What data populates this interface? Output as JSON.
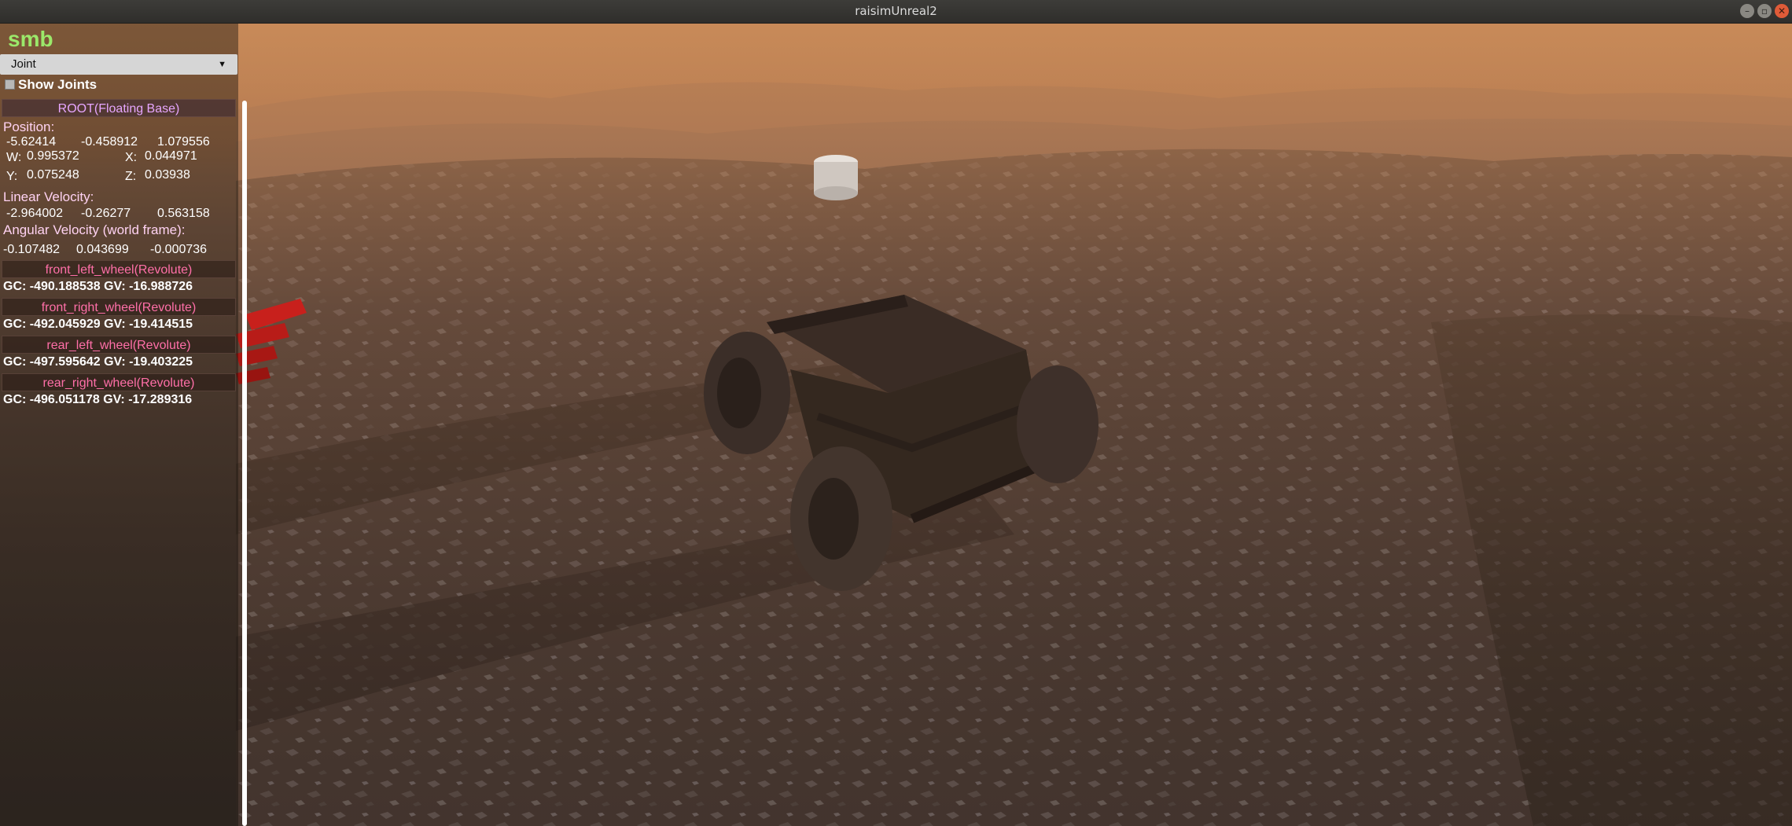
{
  "window": {
    "title": "raisimUnreal2"
  },
  "panel": {
    "object_name": "smb",
    "mode_select": "Joint",
    "show_joints_label": "Show Joints",
    "root": {
      "header": "ROOT(Floating Base)",
      "position_label": "Position:",
      "position": [
        "-5.62414",
        "-0.458912",
        "1.079556"
      ],
      "quat": {
        "w_label": "W:",
        "w": "0.995372",
        "x_label": "X:",
        "x": "0.044971",
        "y_label": "Y:",
        "y": "0.075248",
        "z_label": "Z:",
        "z": "0.03938"
      },
      "lin_vel_label": "Linear Velocity:",
      "lin_vel": [
        "-2.964002",
        "-0.26277",
        "0.563158"
      ],
      "ang_vel_label": "Angular Velocity (world frame):",
      "ang_vel": [
        "-0.107482",
        "0.043699",
        "-0.000736"
      ]
    },
    "joints": [
      {
        "header": "front_left_wheel(Revolute)",
        "state": "GC: -490.188538  GV: -16.988726"
      },
      {
        "header": "front_right_wheel(Revolute)",
        "state": "GC: -492.045929  GV: -19.414515"
      },
      {
        "header": "rear_left_wheel(Revolute)",
        "state": "GC: -497.595642  GV: -19.403225"
      },
      {
        "header": "rear_right_wheel(Revolute)",
        "state": "GC: -496.051178  GV: -17.289316"
      }
    ]
  },
  "colors": {
    "object_name": "#9be86a",
    "joint_header": "#ff6fa8",
    "root_header": "#e7a6ff",
    "close_button": "#e05b38"
  },
  "icons": {
    "minimize": "minimize-icon",
    "maximize": "maximize-icon",
    "close": "close-icon",
    "dropdown": "chevron-down-icon"
  }
}
